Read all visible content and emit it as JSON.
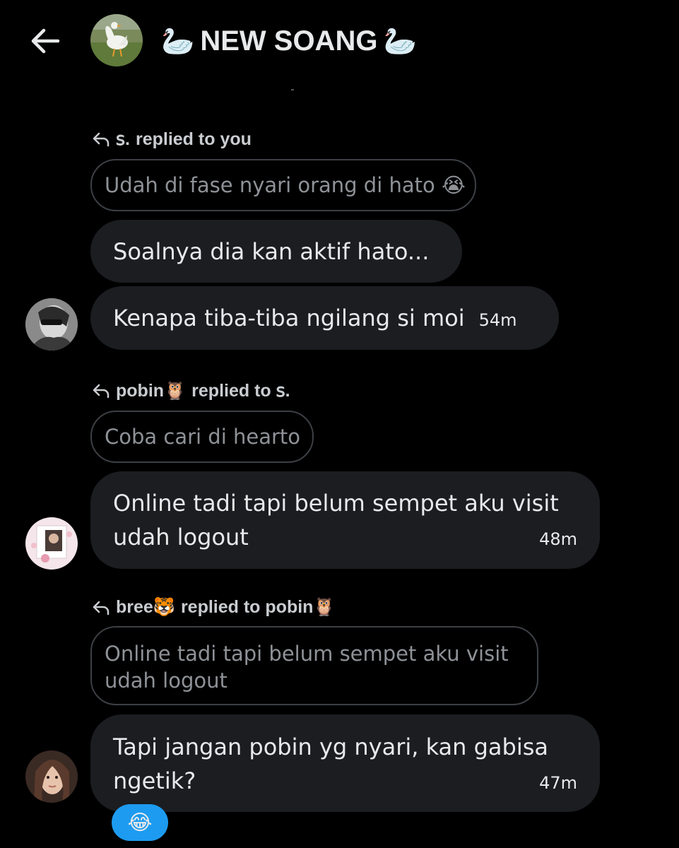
{
  "header": {
    "title": "NEW SOANG",
    "title_emoji_left": "🦢",
    "title_emoji_right": "🦢"
  },
  "icons": {
    "back": "arrow-left-icon",
    "reply": "reply-arrow-icon"
  },
  "colors": {
    "background": "#000000",
    "bubble": "#1b1d21",
    "quote_border": "#3c3f44",
    "reaction": "#1d9bf0"
  },
  "messages": [
    {
      "reply_context": {
        "sender": "ꜱ.",
        "label": "replied to you"
      },
      "quoted": "Udah di fase nyari orang di hato 😭",
      "bubbles": [
        {
          "text": "Soalnya dia kan aktif hato..."
        },
        {
          "text": "Kenapa tiba-tiba ngilang si moi",
          "time": "54m"
        }
      ]
    },
    {
      "reply_context": {
        "sender": "pobin🦉",
        "label": "replied to ꜱ."
      },
      "quoted": "Coba cari di hearto",
      "bubbles": [
        {
          "line1": "Online tadi tapi belum sempet aku visit",
          "line2": "udah logout",
          "time": "48m"
        }
      ]
    },
    {
      "reply_context": {
        "sender": "bree🐯",
        "label": "replied to pobin🦉"
      },
      "quoted_line1": "Online tadi tapi belum sempet aku visit",
      "quoted_line2": "udah logout",
      "bubbles": [
        {
          "line1": "Tapi jangan pobin yg nyari, kan gabisa",
          "line2": "ngetik?",
          "time": "47m"
        }
      ],
      "reaction": "😂"
    }
  ]
}
